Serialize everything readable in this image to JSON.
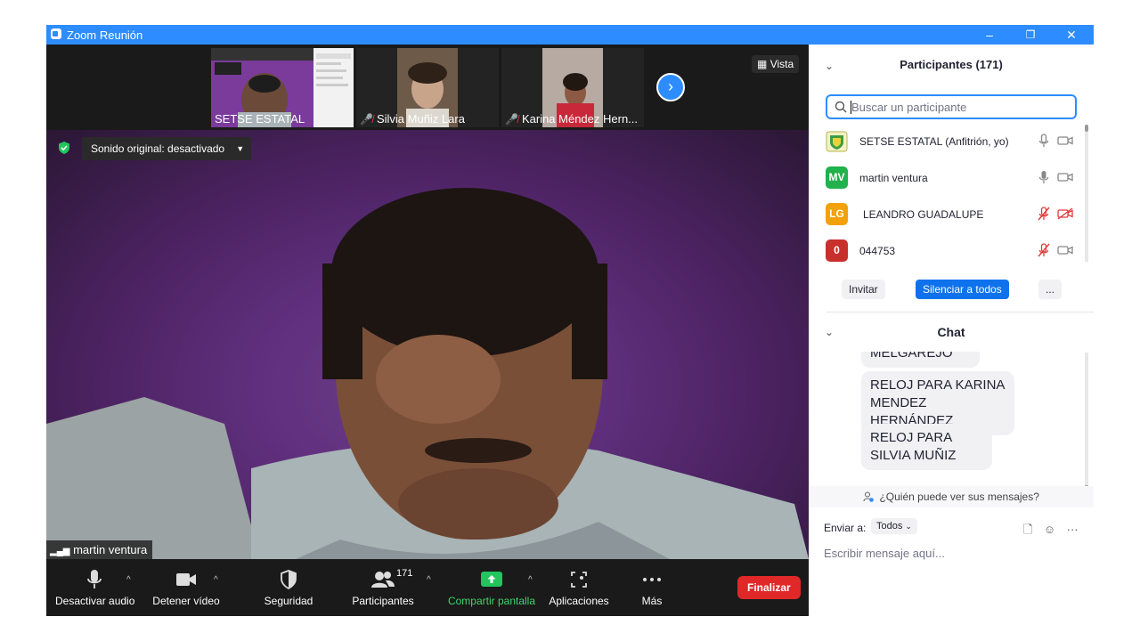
{
  "window": {
    "title": "Zoom Reunión",
    "minimize": "–",
    "restore": "❐",
    "close": "✕"
  },
  "strip": {
    "thumbnails": [
      {
        "name": "SETSE ESTATAL",
        "muted": false
      },
      {
        "name": "Silvia Muñiz Lara",
        "muted": true
      },
      {
        "name": "Karina Méndez Hern...",
        "muted": true
      }
    ],
    "next_label": "›",
    "view_label": "Vista"
  },
  "main_video": {
    "sound_label": "Sonido original: desactivado",
    "speaker_name": "martin ventura"
  },
  "toolbar": {
    "mute_label": "Desactivar audio",
    "video_label": "Detener vídeo",
    "security_label": "Seguridad",
    "participants_label": "Participantes",
    "participants_count": "171",
    "share_label": "Compartir pantalla",
    "apps_label": "Aplicaciones",
    "more_label": "Más",
    "end_label": "Finalizar"
  },
  "participants_panel": {
    "title": "Participantes (171)",
    "search_placeholder": "Buscar un participante",
    "participants": [
      {
        "name": "SETSE ESTATAL (Anfitrión, yo)",
        "initials": "",
        "color": "#c9d84a",
        "mic": "on",
        "cam": "on"
      },
      {
        "name": "martin ventura",
        "initials": "MV",
        "color": "#22b14c",
        "mic": "on",
        "cam": "on"
      },
      {
        "name": "LEANDRO GUADALUPE",
        "initials": "LG",
        "color": "#f2a10a",
        "mic": "off",
        "cam": "off"
      },
      {
        "name": "044753",
        "initials": "0",
        "color": "#c8302c",
        "mic": "off",
        "cam": "on"
      }
    ],
    "invite_label": "Invitar",
    "mute_all_label": "Silenciar a todos",
    "more_label": "..."
  },
  "chat": {
    "title": "Chat",
    "messages": [
      "MELGAREJO",
      "RELOJ PARA KARINA MENDEZ HERNÁNDEZ",
      "RELOJ PARA SILVIA MUÑIZ"
    ],
    "visibility_label": "¿Quién puede ver sus mensajes?",
    "send_to_label": "Enviar a:",
    "send_to_value": "Todos",
    "input_placeholder": "Escribir mensaje aquí..."
  },
  "colors": {
    "accent": "#2d8cff",
    "end_red": "#e02828",
    "share_green": "#22c55e"
  }
}
